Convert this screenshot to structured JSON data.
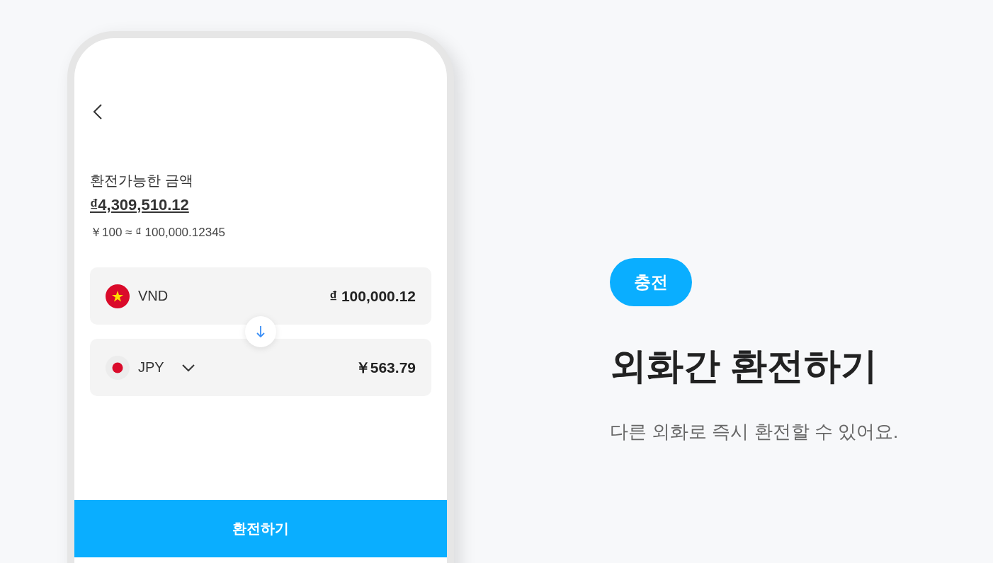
{
  "phone": {
    "label": "환전가능한 금액",
    "balance": "₫4,309,510.12",
    "rate": "￥100 ≈ ₫ 100,000.12345",
    "currencies": [
      {
        "code": "VND",
        "amount": "₫ 100,000.12",
        "dropdown": false
      },
      {
        "code": "JPY",
        "amount": "￥563.79",
        "dropdown": true
      }
    ],
    "button": "환전하기"
  },
  "badge": "충전",
  "heading": "외화간 환전하기",
  "description": "다른 외화로 즉시 환전할 수 있어요."
}
